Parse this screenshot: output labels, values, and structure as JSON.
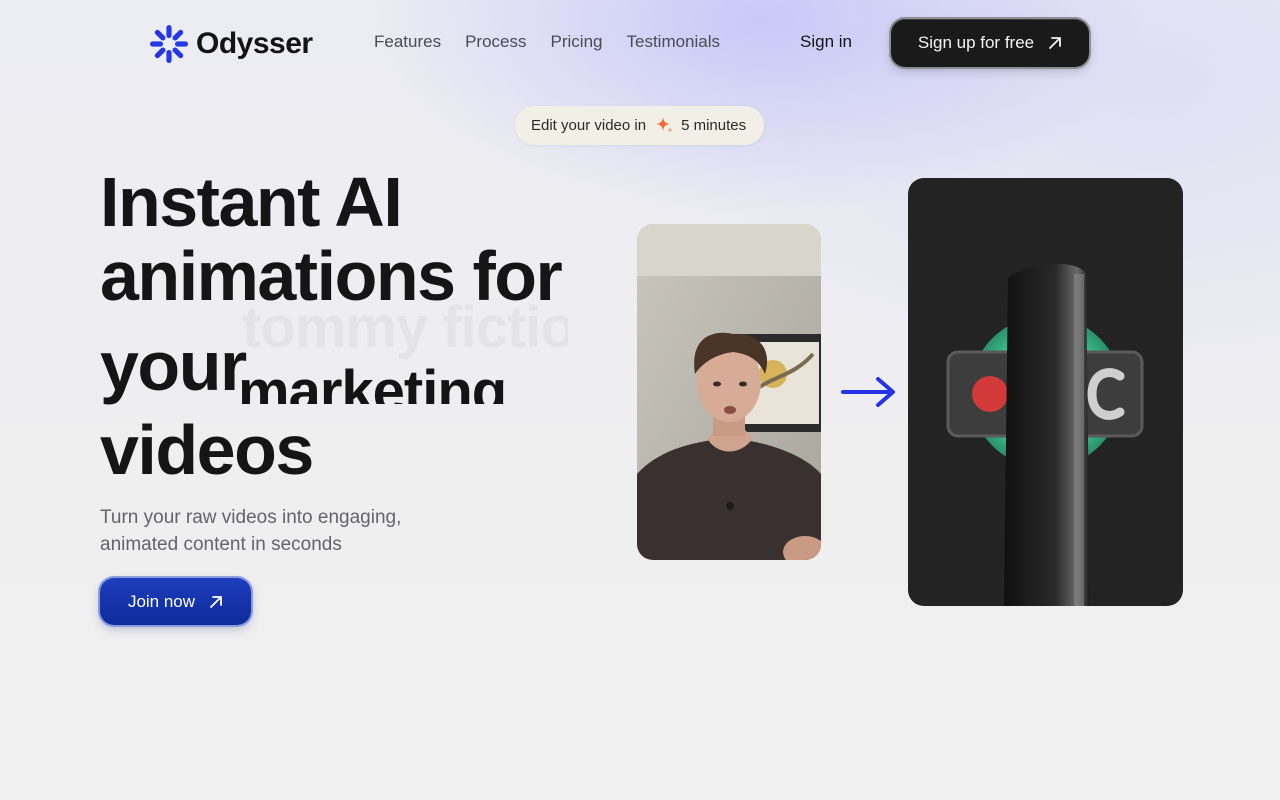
{
  "brand": {
    "name": "Odysser",
    "color": "#2438e8"
  },
  "nav": {
    "links": [
      "Features",
      "Process",
      "Pricing",
      "Testimonials"
    ],
    "signin_label": "Sign in",
    "signup_label": "Sign up for free"
  },
  "badge": {
    "prefix": "Edit your video in",
    "suffix": "5 minutes"
  },
  "hero": {
    "line1": "Instant AI",
    "line2": "animations for",
    "line3": "your",
    "rotating_word": "marketing",
    "rotating_word_previous": "tommy fiction",
    "line4": "videos",
    "subtitle": "Turn your raw videos into engaging, animated content in seconds",
    "cta_label": "Join now"
  },
  "media": {
    "left": "person-video-thumbnail",
    "right": "animated-record-button-clip"
  },
  "colors": {
    "accent": "#2438e8",
    "cta": "#1434b0",
    "dark_button": "#1a1a1a",
    "badge_bg": "#f2f0e6"
  }
}
